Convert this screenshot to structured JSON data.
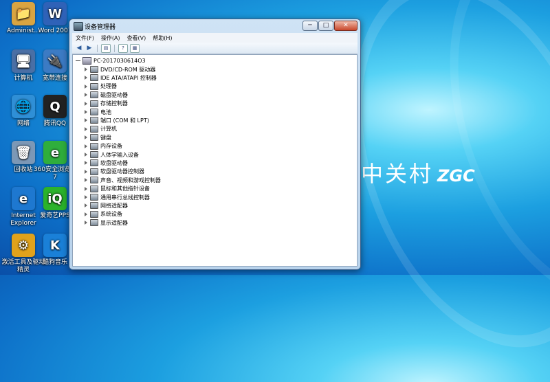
{
  "desktop": {
    "icons": [
      {
        "label": "Administ...",
        "icon": "user-folder-icon",
        "color": "#d9a441"
      },
      {
        "label": "Word 2007",
        "icon": "word-doc-icon",
        "color": "#2f62b8"
      },
      {
        "label": "计算机",
        "icon": "computer-icon",
        "color": "#4a6fa5"
      },
      {
        "label": "宽带连接",
        "icon": "broadband-icon",
        "color": "#3c7bc4"
      },
      {
        "label": "网络",
        "icon": "network-icon",
        "color": "#2f8fd6"
      },
      {
        "label": "腾讯QQ",
        "icon": "qq-penguin-icon",
        "color": "#222222"
      },
      {
        "label": "回收站",
        "icon": "recycle-bin-icon",
        "color": "#7c98b6"
      },
      {
        "label": "360安全浏览器7",
        "icon": "browser-360-icon",
        "color": "#2fae3c"
      },
      {
        "label": "Internet Explorer",
        "icon": "ie-icon",
        "color": "#1e78d0"
      },
      {
        "label": "爱奇艺PPS",
        "icon": "iqiyi-icon",
        "color": "#2bb32b"
      },
      {
        "label": "激活工具及驱动精灵",
        "icon": "tools-icon",
        "color": "#e0a21c"
      },
      {
        "label": "酷狗音乐",
        "icon": "kugou-icon",
        "color": "#1a80d8"
      }
    ],
    "brand": {
      "main": "中关村",
      "sub": "ZGC"
    }
  },
  "window": {
    "title": "设备管理器",
    "buttons": {
      "minimize": "─",
      "maximize": "□",
      "close": "✕"
    },
    "menu": [
      "文件(F)",
      "操作(A)",
      "查看(V)",
      "帮助(H)"
    ],
    "toolbar_icons": [
      "back-arrow-icon",
      "forward-arrow-icon",
      "device-view-icon",
      "help-icon",
      "properties-icon"
    ],
    "tree": {
      "root": "PC-2017030614O3",
      "items": [
        "DVD/CD-ROM 驱动器",
        "IDE ATA/ATAPI 控制器",
        "处理器",
        "磁盘驱动器",
        "存储控制器",
        "电池",
        "端口 (COM 和 LPT)",
        "计算机",
        "键盘",
        "内存设备",
        "人体学输入设备",
        "软盘驱动器",
        "软盘驱动器控制器",
        "声音、视频和游戏控制器",
        "鼠标和其他指针设备",
        "通用串行总线控制器",
        "网络适配器",
        "系统设备",
        "显示适配器"
      ]
    }
  }
}
